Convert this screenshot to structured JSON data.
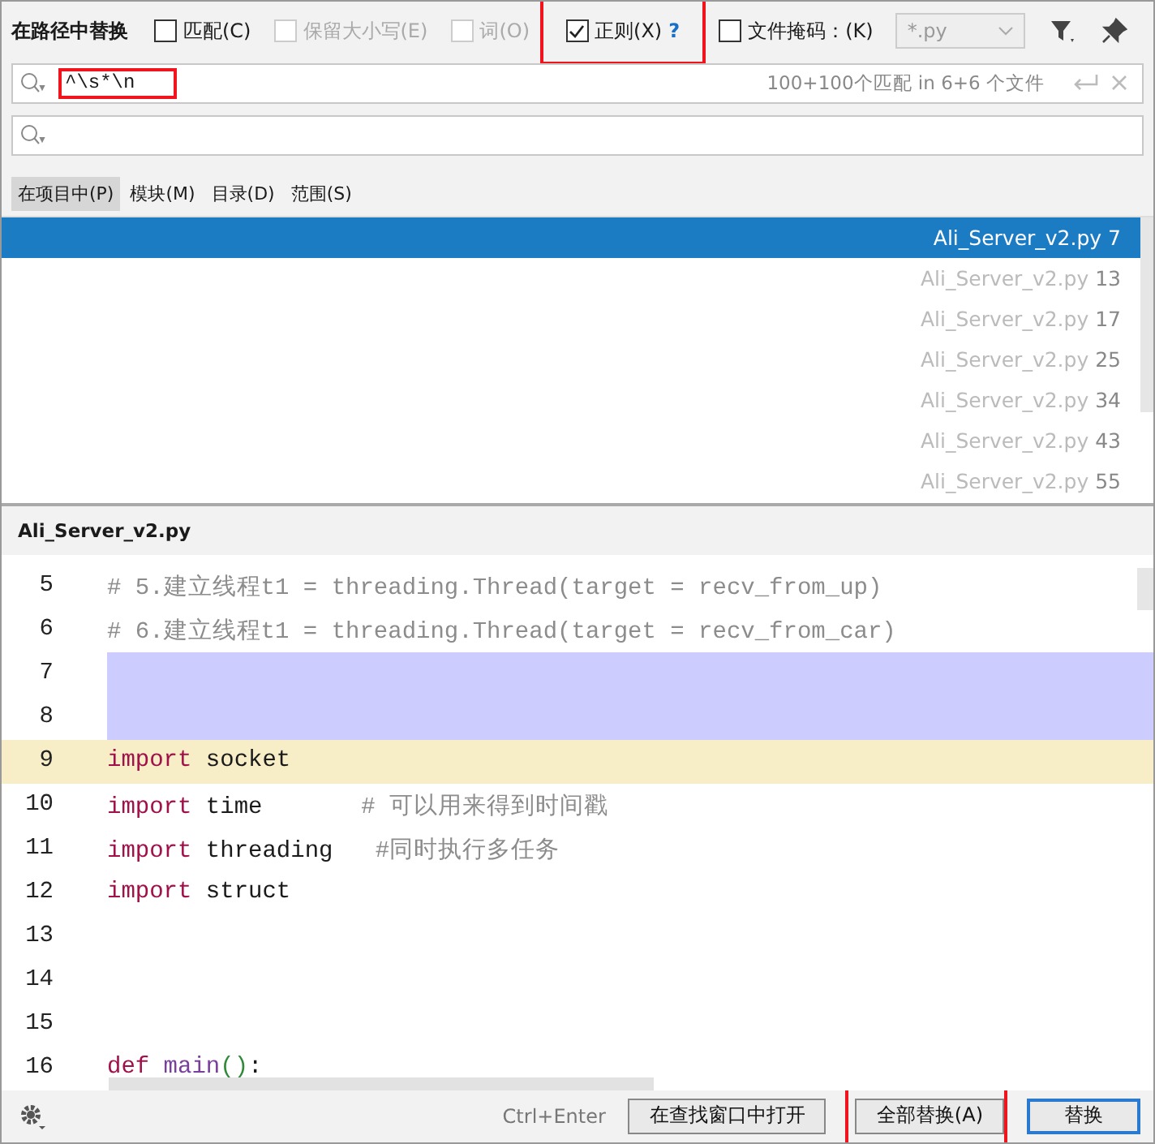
{
  "window": {
    "title": "在路径中替换"
  },
  "options": [
    {
      "label": "匹配(C)",
      "checked": false,
      "disabled": false,
      "annotated": false
    },
    {
      "label": "保留大小写(E)",
      "checked": false,
      "disabled": true,
      "annotated": false
    },
    {
      "label": "词(O)",
      "checked": false,
      "disabled": true,
      "annotated": false
    },
    {
      "label": "正则(X)",
      "checked": true,
      "disabled": false,
      "annotated": true,
      "help": "?"
    },
    {
      "label": "文件掩码：(K)",
      "checked": false,
      "disabled": false,
      "annotated": false
    }
  ],
  "file_mask": {
    "value": "*.py",
    "disabled": true
  },
  "search": {
    "value": "^\\s*\\n",
    "match_info": "100+100个匹配 in 6+6 个文件",
    "annotated": true
  },
  "scopes": [
    {
      "label": "在项目中(P)",
      "selected": true
    },
    {
      "label": "模块(M)",
      "selected": false
    },
    {
      "label": "目录(D)",
      "selected": false
    },
    {
      "label": "范围(S)",
      "selected": false
    }
  ],
  "results": [
    {
      "file": "Ali_Server_v2.py",
      "line": "7",
      "selected": true
    },
    {
      "file": "Ali_Server_v2.py",
      "line": "13",
      "selected": false
    },
    {
      "file": "Ali_Server_v2.py",
      "line": "17",
      "selected": false
    },
    {
      "file": "Ali_Server_v2.py",
      "line": "25",
      "selected": false
    },
    {
      "file": "Ali_Server_v2.py",
      "line": "34",
      "selected": false
    },
    {
      "file": "Ali_Server_v2.py",
      "line": "43",
      "selected": false
    },
    {
      "file": "Ali_Server_v2.py",
      "line": "55",
      "selected": false
    }
  ],
  "preview": {
    "file": "Ali_Server_v2.py",
    "lines": [
      {
        "number": "5",
        "matched": false,
        "current": false,
        "tokens": [
          {
            "kind": "comment",
            "text": "# 5.建立线程t1 = threading.Thread(target = recv_from_up)"
          }
        ]
      },
      {
        "number": "6",
        "matched": false,
        "current": false,
        "tokens": [
          {
            "kind": "comment",
            "text": "# 6.建立线程t1 = threading.Thread(target = recv_from_car)"
          }
        ]
      },
      {
        "number": "7",
        "matched": true,
        "current": false
      },
      {
        "number": "8",
        "matched": true,
        "current": false
      },
      {
        "number": "9",
        "matched": false,
        "current": true,
        "tokens": [
          {
            "kind": "keyword",
            "text": "import"
          },
          {
            "kind": "plain",
            "text": " socket"
          }
        ]
      },
      {
        "number": "10",
        "matched": false,
        "current": false,
        "tokens": [
          {
            "kind": "keyword",
            "text": "import"
          },
          {
            "kind": "plain",
            "text": " time       "
          },
          {
            "kind": "comment",
            "text": "# 可以用来得到时间戳"
          }
        ]
      },
      {
        "number": "11",
        "matched": false,
        "current": false,
        "tokens": [
          {
            "kind": "keyword",
            "text": "import"
          },
          {
            "kind": "plain",
            "text": " threading   "
          },
          {
            "kind": "comment",
            "text": "#同时执行多任务"
          }
        ]
      },
      {
        "number": "12",
        "matched": false,
        "current": false,
        "tokens": [
          {
            "kind": "keyword",
            "text": "import"
          },
          {
            "kind": "plain",
            "text": " struct"
          }
        ]
      },
      {
        "number": "13",
        "matched": false,
        "current": false
      },
      {
        "number": "14",
        "matched": false,
        "current": false
      },
      {
        "number": "15",
        "matched": false,
        "current": false
      },
      {
        "number": "16",
        "matched": false,
        "current": false,
        "tokens": [
          {
            "kind": "keyword",
            "text": "def"
          },
          {
            "kind": "function",
            "text": " main"
          },
          {
            "kind": "paren",
            "text": "()"
          },
          {
            "kind": "plain",
            "text": ":"
          }
        ]
      }
    ]
  },
  "footer": {
    "shortcut": "Ctrl+Enter",
    "buttons": [
      {
        "label": "在查找窗口中打开",
        "kind": "normal",
        "annotated": false
      },
      {
        "label": "全部替换(A)",
        "kind": "normal",
        "annotated": true
      },
      {
        "label": "替换",
        "kind": "default",
        "annotated": false
      }
    ]
  }
}
